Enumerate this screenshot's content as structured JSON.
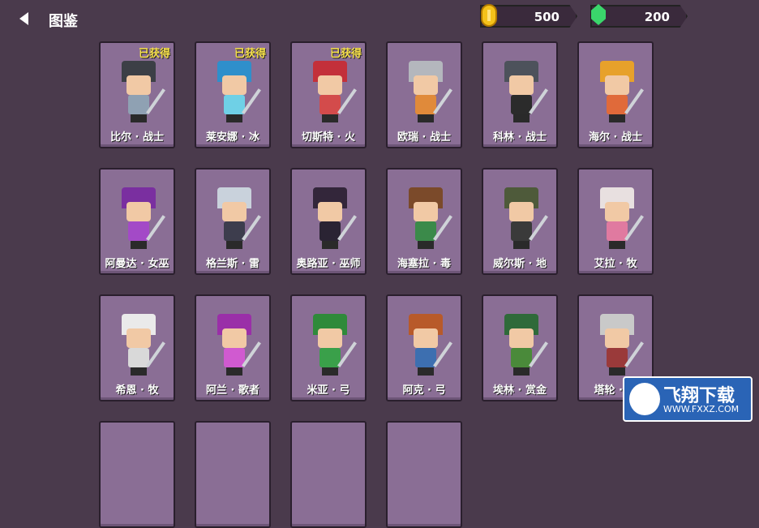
{
  "header": {
    "title": "图鉴"
  },
  "currency": {
    "coins": "500",
    "gems": "200"
  },
  "cards": [
    {
      "name": "比尔 · 战士",
      "badge": "已获得",
      "hat": "#3c3f46",
      "body": "#8fa1b3"
    },
    {
      "name": "莱安娜 · 冰",
      "badge": "已获得",
      "hat": "#2f8fcb",
      "body": "#6fd0e6"
    },
    {
      "name": "切斯特 · 火",
      "badge": "已获得",
      "hat": "#c3303a",
      "body": "#d34b4b"
    },
    {
      "name": "欧瑞 · 战士",
      "badge": "",
      "hat": "#b4b7bd",
      "body": "#e08a3a"
    },
    {
      "name": "科林 · 战士",
      "badge": "",
      "hat": "#4d525b",
      "body": "#2b2b2b"
    },
    {
      "name": "海尔 · 战士",
      "badge": "",
      "hat": "#e7a12b",
      "body": "#e06a3a"
    },
    {
      "name": "阿曼达 · 女巫",
      "badge": "",
      "hat": "#7a2fa0",
      "body": "#a34ac7"
    },
    {
      "name": "格兰斯 · 雷",
      "badge": "",
      "hat": "#c9d2dc",
      "body": "#3d3d4d"
    },
    {
      "name": "奥路亚 · 巫师",
      "badge": "",
      "hat": "#33263a",
      "body": "#2a2333"
    },
    {
      "name": "海塞拉 · 毒",
      "badge": "",
      "hat": "#7b4a2a",
      "body": "#3b8a4a"
    },
    {
      "name": "威尔斯 · 地",
      "badge": "",
      "hat": "#4e5a3a",
      "body": "#3a3a3a"
    },
    {
      "name": "艾拉 · 牧",
      "badge": "",
      "hat": "#e8e0e0",
      "body": "#e07aa0"
    },
    {
      "name": "希恩 · 牧",
      "badge": "",
      "hat": "#eaeaea",
      "body": "#d9d9d9"
    },
    {
      "name": "阿兰 · 歌者",
      "badge": "",
      "hat": "#9a2fa8",
      "body": "#d05ad0"
    },
    {
      "name": "米亚 · 弓",
      "badge": "",
      "hat": "#2f8a3a",
      "body": "#3aa04a"
    },
    {
      "name": "阿克 · 弓",
      "badge": "",
      "hat": "#b85a2a",
      "body": "#3d6fb0"
    },
    {
      "name": "埃林 · 赏金",
      "badge": "",
      "hat": "#2f6a3a",
      "body": "#4a8a3a"
    },
    {
      "name": "塔轮 · 猎",
      "badge": "",
      "hat": "#c9c9c9",
      "body": "#9a3a3a"
    }
  ],
  "watermark": {
    "text": "飞翔下载",
    "url": "WWW.FXXZ.COM"
  }
}
